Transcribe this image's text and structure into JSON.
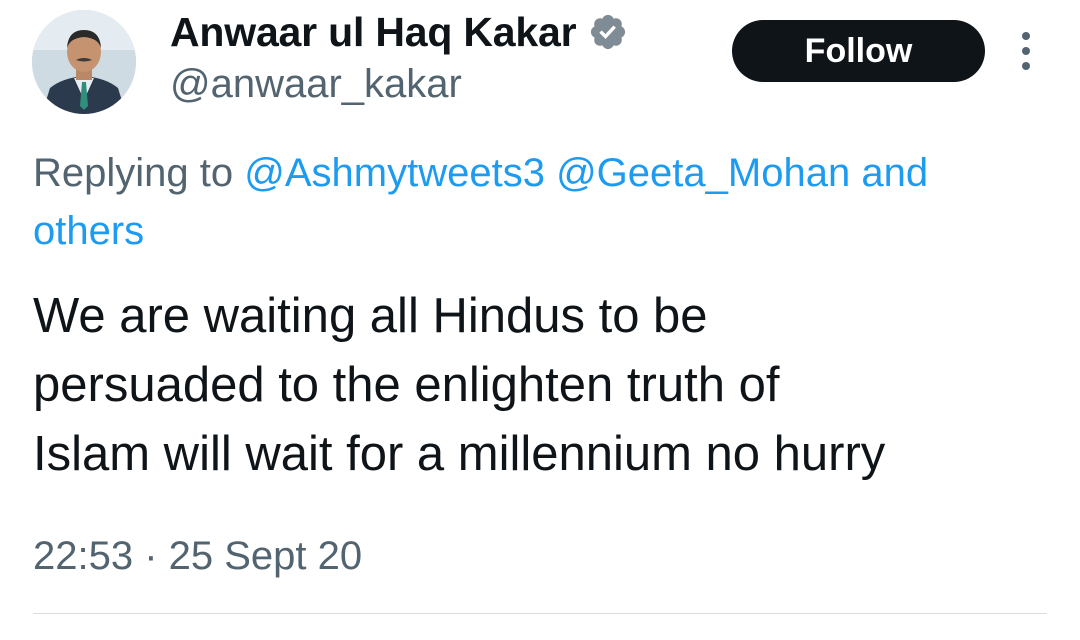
{
  "author": {
    "display_name": "Anwaar ul Haq Kakar",
    "handle": "@anwaar_kakar",
    "verified_icon": "verified-badge-icon",
    "badge_color": "#7f8c96"
  },
  "actions": {
    "follow_label": "Follow",
    "more_icon": "more-vertical-icon"
  },
  "reply_context": {
    "prefix": "Replying to",
    "mentions": [
      "@Ashmytweets3",
      "@Geeta_Mohan",
      "and"
    ],
    "trailing": "others"
  },
  "tweet": {
    "lines": [
      "We are waiting all Hindus to be",
      "persuaded to the enlighten truth of",
      "Islam will wait for a millennium no hurry"
    ],
    "timestamp": "22:53 · 25 Sept 20"
  },
  "colors": {
    "link": "#1d9bf0",
    "secondary_text": "#536471",
    "primary_text": "#0f1419",
    "follow_bg": "#0f1419"
  }
}
